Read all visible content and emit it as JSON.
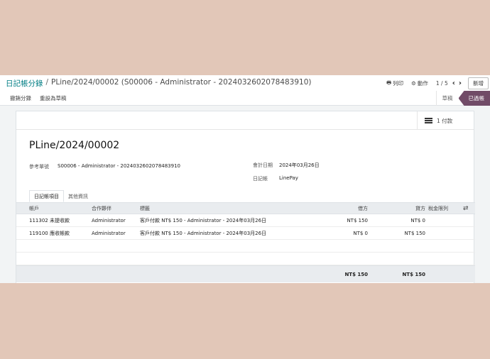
{
  "breadcrumb": {
    "parent": "日記帳分錄",
    "separator": "/",
    "current": "PLine/2024/00002 (S00006 - Administrator - 2024032602078483910)"
  },
  "control": {
    "print_label": "列印",
    "action_label": "動作",
    "pager": "1 / 5",
    "new_label": "新增"
  },
  "header_buttons": {
    "reverse": "撤銷分錄",
    "reset_draft": "重設為草稿"
  },
  "statusbar": {
    "draft": "草稿",
    "posted": "已過帳"
  },
  "stat_button": {
    "label": "1 付款"
  },
  "record": {
    "title": "PLine/2024/00002",
    "ref_label": "參考單號",
    "ref_value": "S00006 - Administrator - 2024032602078483910",
    "date_label": "會計日期",
    "date_value": "2024年03月26日",
    "journal_label": "日記帳",
    "journal_value": "LinePay"
  },
  "tabs": [
    "日記帳項目",
    "其他資訊"
  ],
  "table": {
    "headers": {
      "account": "帳戶",
      "partner": "合作夥伴",
      "label": "標籤",
      "debit": "借方",
      "credit": "貸方",
      "tax_grid": "稅金限列"
    },
    "rows": [
      {
        "account": "111302 未提收款",
        "partner": "Administrator",
        "label": "客戶付款 NT$ 150 - Administrator - 2024年03月26日",
        "debit": "NT$ 150",
        "credit": "NT$ 0"
      },
      {
        "account": "119100 應收帳款",
        "partner": "Administrator",
        "label": "客戶付款 NT$ 150 - Administrator - 2024年03月26日",
        "debit": "NT$ 0",
        "credit": "NT$ 150"
      }
    ],
    "totals": {
      "debit": "NT$ 150",
      "credit": "NT$ 150"
    }
  },
  "colors": {
    "accent": "#714b67",
    "link": "#017e84",
    "backdrop": "#e2c7b8"
  }
}
